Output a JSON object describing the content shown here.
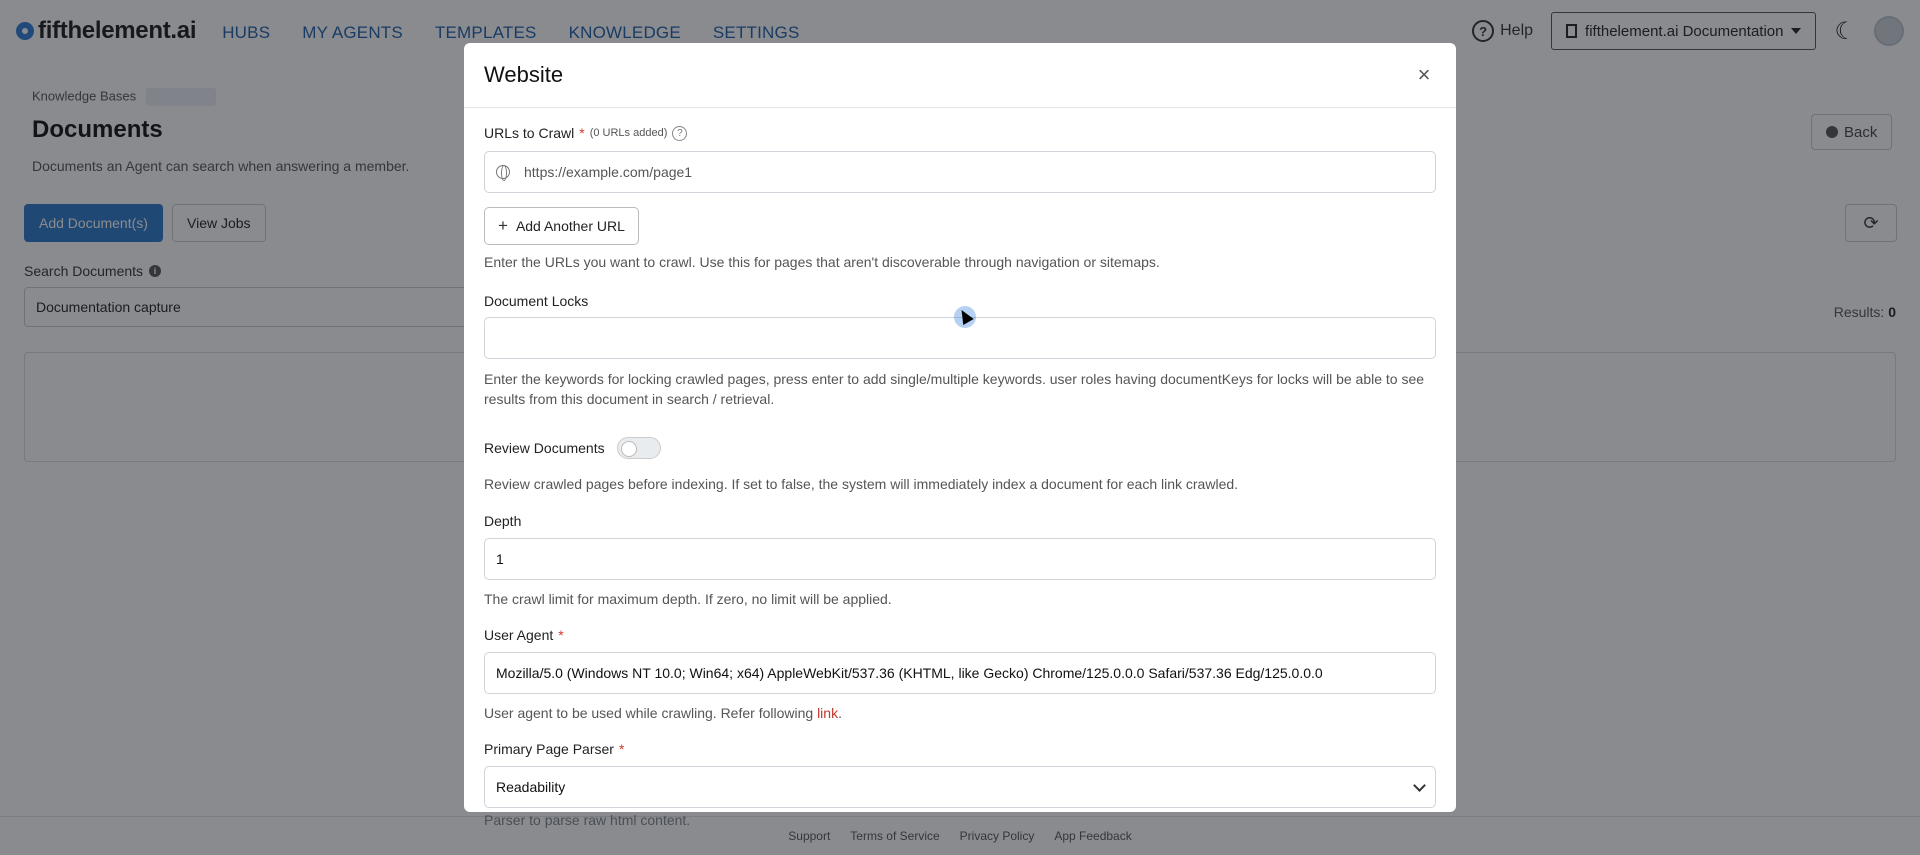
{
  "nav": {
    "logo": "fifthelement.ai",
    "links": [
      "HUBS",
      "MY AGENTS",
      "TEMPLATES",
      "KNOWLEDGE",
      "SETTINGS"
    ],
    "help": "Help",
    "org": "fifthelement.ai Documentation"
  },
  "page": {
    "breadcrumb": "Knowledge Bases",
    "title": "Documents",
    "description": "Documents an Agent can search when answering a member.",
    "back": "Back",
    "add_button": "Add Document(s)",
    "view_jobs": "View Jobs",
    "search_label": "Search Documents",
    "search_value": "Documentation capture",
    "results_label": "Results:",
    "results_count": "0"
  },
  "footer": [
    "Support",
    "Terms of Service",
    "Privacy Policy",
    "App Feedback"
  ],
  "modal": {
    "title": "Website",
    "close": "×",
    "urls_label": "URLs to Crawl",
    "urls_count": "(0 URLs added)",
    "url_placeholder": "https://example.com/page1",
    "add_url": "Add Another URL",
    "urls_help": "Enter the URLs you want to crawl. Use this for pages that aren't discoverable through navigation or sitemaps.",
    "locks_label": "Document Locks",
    "locks_help": "Enter the keywords for locking crawled pages, press enter to add single/multiple keywords. user roles having documentKeys for locks will be able to see results from this document in search / retrieval.",
    "review_label": "Review Documents",
    "review_help": "Review crawled pages before indexing. If set to false, the system will immediately index a document for each link crawled.",
    "depth_label": "Depth",
    "depth_value": "1",
    "depth_help": "The crawl limit for maximum depth. If zero, no limit will be applied.",
    "ua_label": "User Agent",
    "ua_value": "Mozilla/5.0 (Windows NT 10.0; Win64; x64) AppleWebKit/537.36 (KHTML, like Gecko) Chrome/125.0.0.0 Safari/537.36 Edg/125.0.0.0",
    "ua_help": "User agent to be used while crawling. Refer following",
    "ua_link": "link",
    "parser_label": "Primary Page Parser",
    "parser_value": "Readability",
    "parser_help": "Parser to parse raw html content."
  },
  "colors": {
    "primary": "#2a78c8",
    "required": "#d0392f",
    "link": "#c0392b"
  }
}
